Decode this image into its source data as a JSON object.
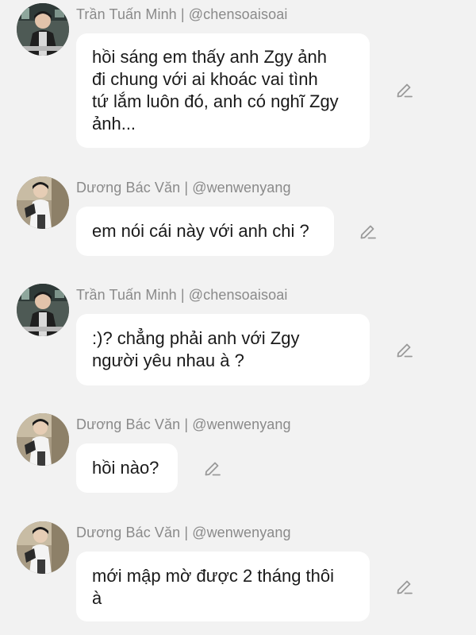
{
  "messages": [
    {
      "sender": "Trần Tuấn Minh | @chensoaisoai",
      "avatar_icon": "avatar-tran-tuan-minh",
      "lines": [
        "hồi sáng em thấy anh Zgy ảnh",
        "đi chung với ai khoác vai tình",
        "tứ lắm luôn đó, anh có nghĩ Zgy",
        "ảnh..."
      ],
      "edit_icon": "pencil-icon"
    },
    {
      "sender": "Dương Bác Văn | @wenwenyang",
      "avatar_icon": "avatar-duong-bac-van",
      "lines": [
        "em nói cái này với anh chi ?"
      ],
      "edit_icon": "pencil-icon"
    },
    {
      "sender": "Trần Tuấn Minh | @chensoaisoai",
      "avatar_icon": "avatar-tran-tuan-minh",
      "lines": [
        ":)? chẳng phải anh với Zgy",
        "người yêu nhau à ?"
      ],
      "edit_icon": "pencil-icon"
    },
    {
      "sender": "Dương Bác Văn | @wenwenyang",
      "avatar_icon": "avatar-duong-bac-van",
      "lines": [
        "hồi nào?"
      ],
      "edit_icon": "pencil-icon"
    },
    {
      "sender": "Dương Bác Văn | @wenwenyang",
      "avatar_icon": "avatar-duong-bac-van",
      "lines": [
        "mới mập mờ được 2 tháng thôi",
        "à"
      ],
      "edit_icon": "pencil-icon"
    }
  ],
  "colors": {
    "background": "#f2f2f2",
    "bubble": "#ffffff",
    "sender_text": "#8a8a8a",
    "message_text": "#1a1a1a",
    "icon": "#9a9a9a"
  }
}
